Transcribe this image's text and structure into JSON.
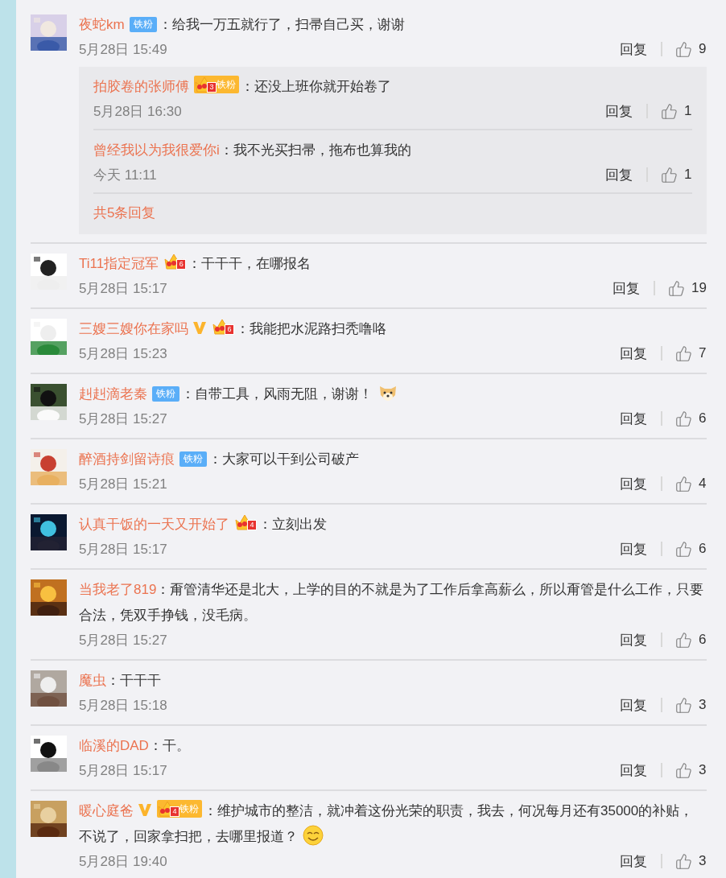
{
  "comments": [
    {
      "user": "夜蛇km",
      "badges": [
        {
          "kind": "fan",
          "label": "铁粉"
        }
      ],
      "text": "：给我一万五就行了，扫帚自己买，谢谢",
      "time": "5月28日 15:49",
      "reply": "回复",
      "likes": "9",
      "replies": {
        "items": [
          {
            "user": "拍胶卷的张师傅",
            "badges": [
              {
                "kind": "crown_fan",
                "level": "3",
                "label": "铁粉"
              }
            ],
            "text": "：还没上班你就开始卷了",
            "time": "5月28日 16:30",
            "reply": "回复",
            "likes": "1"
          },
          {
            "user": "曾经我以为我很爱你i",
            "text": "：我不光买扫帚，拖布也算我的",
            "time": "今天 11:11",
            "reply": "回复",
            "likes": "1"
          }
        ],
        "more": "共5条回复"
      }
    },
    {
      "user": "Ti11指定冠军",
      "badges": [
        {
          "kind": "crown",
          "level": "6"
        }
      ],
      "text": "：干干干，在哪报名",
      "time": "5月28日 15:17",
      "reply": "回复",
      "likes": "19"
    },
    {
      "user": "三嫂三嫂你在家吗",
      "badges": [
        {
          "kind": "verified"
        },
        {
          "kind": "crown",
          "level": "6"
        }
      ],
      "text": "：我能把水泥路扫秃噜咯",
      "time": "5月28日 15:23",
      "reply": "回复",
      "likes": "7"
    },
    {
      "user": "赳赳滴老秦",
      "badges": [
        {
          "kind": "fan",
          "label": "铁粉"
        }
      ],
      "text": "：自带工具，风雨无阻，谢谢！",
      "emoji": {
        "kind": "dog"
      },
      "time": "5月28日 15:27",
      "reply": "回复",
      "likes": "6"
    },
    {
      "user": "醉酒持剑留诗痕",
      "badges": [
        {
          "kind": "fan",
          "label": "铁粉"
        }
      ],
      "text": "：大家可以干到公司破产",
      "time": "5月28日 15:21",
      "reply": "回复",
      "likes": "4"
    },
    {
      "user": "认真干饭的一天又开始了",
      "badges": [
        {
          "kind": "crown",
          "level": "4"
        }
      ],
      "text": "：立刻出发",
      "time": "5月28日 15:17",
      "reply": "回复",
      "likes": "6"
    },
    {
      "user": "当我老了819",
      "text": "：甭管清华还是北大，上学的目的不就是为了工作后拿高薪么，所以甭管是什么工作，只要合法，凭双手挣钱，没毛病。",
      "time": "5月28日 15:27",
      "reply": "回复",
      "likes": "6"
    },
    {
      "user": "魔虫",
      "text": "：干干干",
      "time": "5月28日 15:18",
      "reply": "回复",
      "likes": "3"
    },
    {
      "user": "临溪的DAD",
      "text": "：干。",
      "time": "5月28日 15:17",
      "reply": "回复",
      "likes": "3"
    },
    {
      "user": "暖心庭爸",
      "badges": [
        {
          "kind": "verified"
        },
        {
          "kind": "crown_fan",
          "level": "4",
          "label": "铁粉"
        }
      ],
      "text": "：维护城市的整洁，就冲着这份光荣的职责，我去，何况每月还有35000的补贴，不说了，回家拿扫把，去哪里报道？",
      "emoji": {
        "kind": "smile"
      },
      "time": "5月28日 19:40",
      "reply": "回复",
      "likes": "3"
    }
  ]
}
